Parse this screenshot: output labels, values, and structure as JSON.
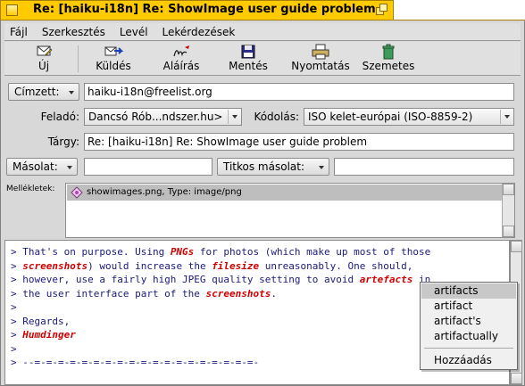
{
  "window": {
    "title": "Re: [haiku-i18n] Re: ShowImage user guide problem"
  },
  "menubar": {
    "items": [
      "Fájl",
      "Szerkesztés",
      "Levél",
      "Lekérdezések"
    ]
  },
  "toolbar": {
    "buttons": [
      {
        "label": "Új",
        "icon": "new-mail-icon"
      },
      {
        "label": "Küldés",
        "icon": "send-icon"
      },
      {
        "label": "Aláírás",
        "icon": "signature-icon"
      },
      {
        "label": "Mentés",
        "icon": "save-icon"
      },
      {
        "label": "Nyomtatás",
        "icon": "print-icon"
      },
      {
        "label": "Szemetes",
        "icon": "trash-icon"
      }
    ]
  },
  "form": {
    "to_button": "Címzett:",
    "to_value": "haiku-i18n@freelist.org",
    "from_label": "Feladó:",
    "from_value": "Dancsó Rób...ndszer.hu>",
    "encoding_label": "Kódolás:",
    "encoding_value": "ISO kelet-európai (ISO-8859-2)",
    "subject_label": "Tárgy:",
    "subject_value": "Re: [haiku-i18n] Re: ShowImage user guide problem",
    "cc_button": "Másolat:",
    "cc_value": "",
    "bcc_button": "Titkos másolat:",
    "bcc_value": "",
    "attachments_label": "Mellékletek:",
    "attachments": [
      {
        "text": "showimages.png, Type: image/png"
      }
    ]
  },
  "body": {
    "lines": [
      [
        {
          "t": "> That's on purpose. Using "
        },
        {
          "t": "PNGs",
          "r": true
        },
        {
          "t": " for photos (which make up most of those"
        }
      ],
      [
        {
          "t": "> "
        },
        {
          "t": "screenshots",
          "r": true
        },
        {
          "t": ") would increase the "
        },
        {
          "t": "filesize",
          "r": true
        },
        {
          "t": " unreasonably. One should,"
        }
      ],
      [
        {
          "t": "> however, use a fairly high JPEG quality setting to avoid "
        },
        {
          "t": "artefacts",
          "r": true
        },
        {
          "t": " in"
        }
      ],
      [
        {
          "t": "> the user interface part of the "
        },
        {
          "t": "screenshots",
          "r": true
        },
        {
          "t": "."
        }
      ],
      [
        {
          "t": ">"
        }
      ],
      [
        {
          "t": "> Regards,"
        }
      ],
      [
        {
          "t": "> "
        },
        {
          "t": "Humdinger",
          "r": true
        }
      ],
      [
        {
          "t": ">"
        }
      ],
      [
        {
          "t": "> --=-=-=-=-=-=-=-=-=-=-=-=-=-=-=-=-=-=-=-"
        }
      ]
    ]
  },
  "context_menu": {
    "suggestions": [
      "artifacts",
      "artifact",
      "artifact's",
      "artifactually"
    ],
    "add_label": "Hozzáadás"
  }
}
